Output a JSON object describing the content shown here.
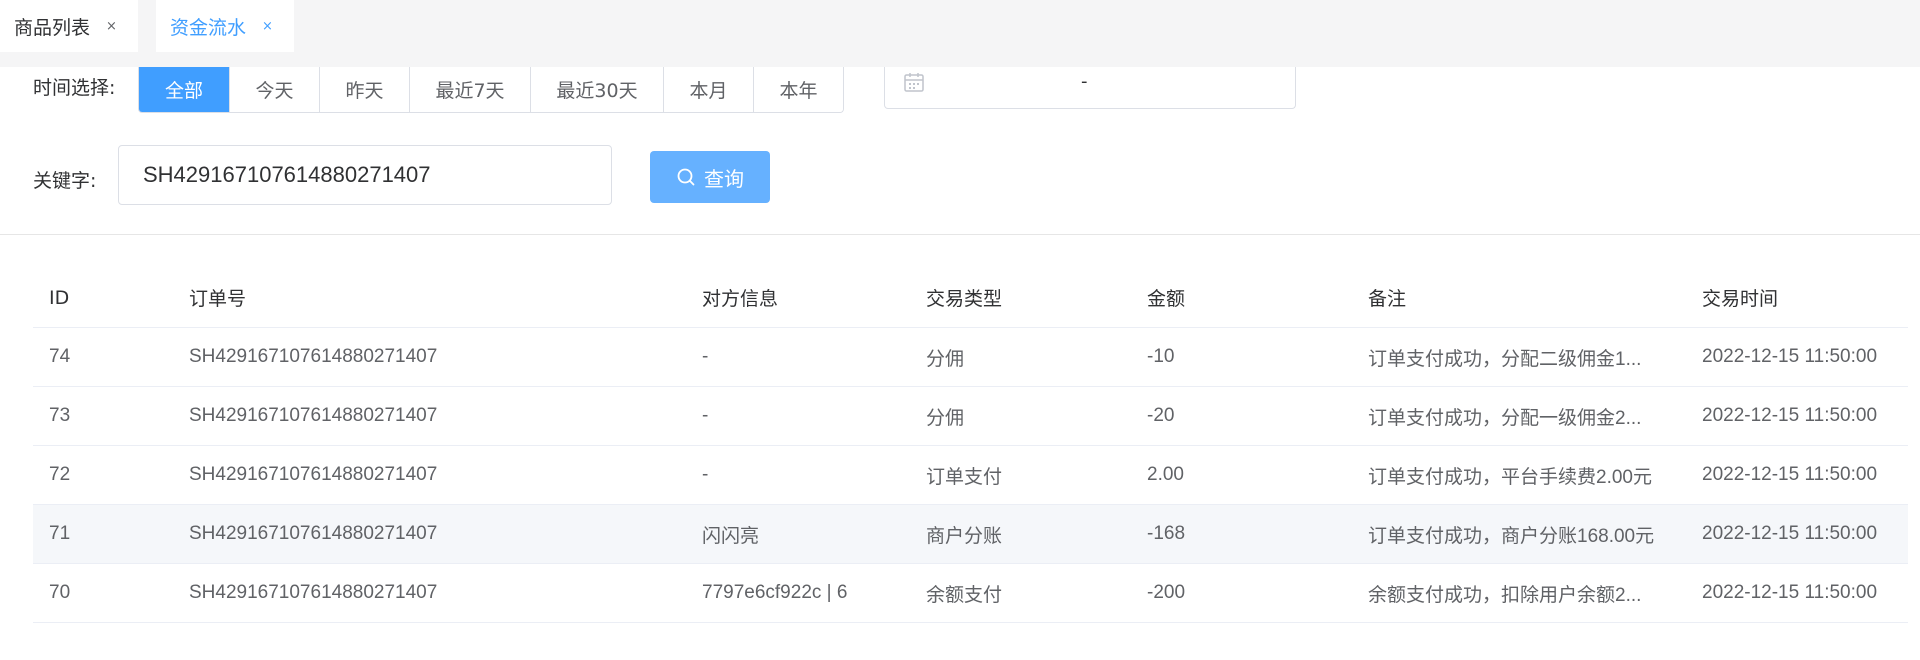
{
  "tabs": [
    {
      "label": "商品列表",
      "close": "×",
      "active": false
    },
    {
      "label": "资金流水",
      "close": "×",
      "active": true
    }
  ],
  "filter": {
    "time_label": "时间选择:",
    "time_options": [
      "全部",
      "今天",
      "昨天",
      "最近7天",
      "最近30天",
      "本月",
      "本年"
    ],
    "time_selected": "全部",
    "date_range_separator": "-",
    "keyword_label": "关键字:",
    "keyword_value": "SH429167107614880271407",
    "search_label": "查询"
  },
  "table": {
    "columns": [
      "ID",
      "订单号",
      "对方信息",
      "交易类型",
      "金额",
      "备注",
      "交易时间"
    ],
    "rows": [
      {
        "id": "74",
        "order": "SH429167107614880271407",
        "party": "-",
        "type": "分佣",
        "amount": "-10",
        "note": "订单支付成功，分配二级佣金1...",
        "time": "2022-12-15 11:50:00"
      },
      {
        "id": "73",
        "order": "SH429167107614880271407",
        "party": "-",
        "type": "分佣",
        "amount": "-20",
        "note": "订单支付成功，分配一级佣金2...",
        "time": "2022-12-15 11:50:00"
      },
      {
        "id": "72",
        "order": "SH429167107614880271407",
        "party": "-",
        "type": "订单支付",
        "amount": "2.00",
        "note": "订单支付成功，平台手续费2.00元",
        "time": "2022-12-15 11:50:00"
      },
      {
        "id": "71",
        "order": "SH429167107614880271407",
        "party": "闪闪亮",
        "type": "商户分账",
        "amount": "-168",
        "note": "订单支付成功，商户分账168.00元",
        "time": "2022-12-15 11:50:00"
      },
      {
        "id": "70",
        "order": "SH429167107614880271407",
        "party": "7797e6cf922c | 6",
        "type": "余额支付",
        "amount": "-200",
        "note": "余额支付成功，扣除用户余额2...",
        "time": "2022-12-15 11:50:00"
      }
    ]
  },
  "colors": {
    "primary": "#409eff",
    "primary_light": "#66b1ff",
    "row_hover": "#f5f7fa"
  }
}
